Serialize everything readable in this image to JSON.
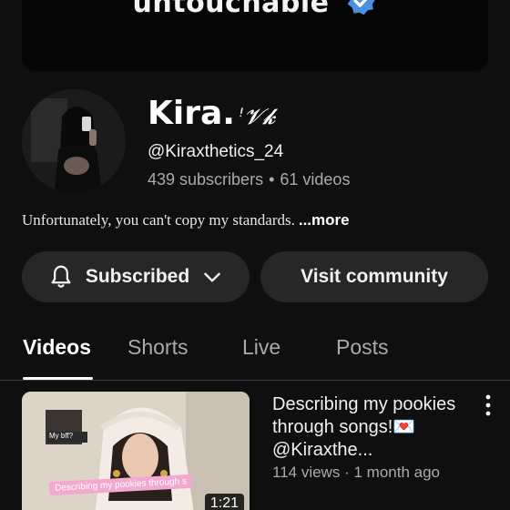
{
  "banner": {
    "text": "untouchable",
    "badge_icon": "verified-badge-icon"
  },
  "channel": {
    "name": "Kira.",
    "name_suffix": "ꜝ𝓥𝓴",
    "handle": "@Kiraxthetics_24",
    "subscribers": "439 subscribers",
    "separator": "•",
    "videos": "61 videos",
    "description": "Unfortunately, you can't copy my standards.",
    "more_label": "...more"
  },
  "actions": {
    "subscribed_label": "Subscribed",
    "community_label": "Visit community"
  },
  "tabs": [
    {
      "label": "Videos",
      "active": true
    },
    {
      "label": "Shorts",
      "active": false
    },
    {
      "label": "Live",
      "active": false
    },
    {
      "label": "Posts",
      "active": false
    }
  ],
  "video": {
    "title": "Describing my pookies through songs!💌 @Kiraxthe...",
    "views": "114 views",
    "separator": "·",
    "age": "1 month ago",
    "duration": "1:21",
    "thumb_caption": "Describing my pookies through s",
    "thumb_corner_text": "My bff?"
  },
  "colors": {
    "background": "#0f0f0f",
    "pill": "#272727",
    "secondary_text": "#aaaaaa",
    "verified": "#4a90e2",
    "thumb_caption_bg": "#f3a8cf"
  }
}
